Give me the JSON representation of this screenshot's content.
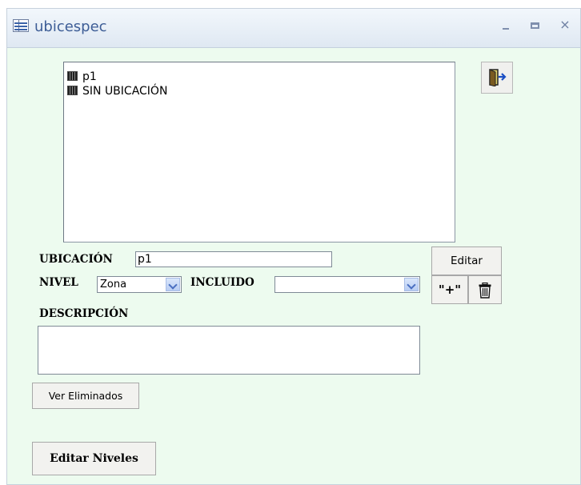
{
  "window": {
    "title": "ubicespec",
    "icon": "form-icon",
    "controls": {
      "minimize": "minimize-icon",
      "maximize": "maximize-icon",
      "close": "×"
    }
  },
  "tree": {
    "items": [
      {
        "label": "p1",
        "icon": "tree-node-icon"
      },
      {
        "label": "SIN UBICACIÓN",
        "icon": "tree-node-icon"
      }
    ]
  },
  "toolbar": {
    "exit_icon": "exit-door-icon",
    "delete_icon": "trash-icon"
  },
  "form": {
    "ubicacion_label": "UBICACIÓN",
    "ubicacion_value": "p1",
    "nivel_label": "NIVEL",
    "nivel_value": "Zona",
    "incluido_label": "INCLUIDO",
    "incluido_value": "",
    "descripcion_label": "DESCRIPCIÓN",
    "descripcion_value": ""
  },
  "buttons": {
    "editar": "Editar",
    "add": "\"+\"",
    "ver_eliminados": "Ver Eliminados",
    "editar_niveles": "Editar Niveles"
  },
  "colors": {
    "form_bg": "#edfbef",
    "title_text": "#3d5d96"
  }
}
